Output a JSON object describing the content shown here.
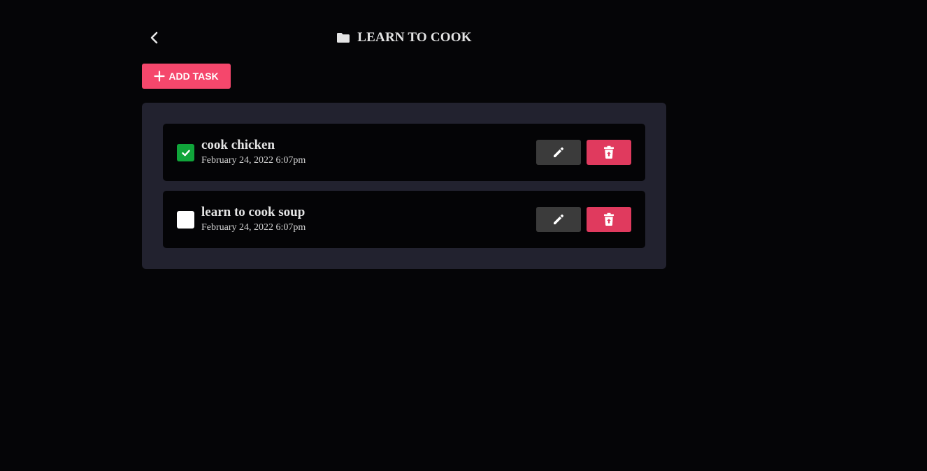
{
  "header": {
    "back_icon": "chevron-left-icon",
    "folder_icon": "folder-icon",
    "title": "LEARN TO COOK"
  },
  "toolbar": {
    "add_icon": "plus-icon",
    "add_label": "ADD TASK"
  },
  "tasks": [
    {
      "name": "cook chicken",
      "date": "February 24, 2022 6:07pm",
      "completed": true,
      "edit_icon": "pencil-icon",
      "delete_icon": "trash-icon"
    },
    {
      "name": "learn to cook soup",
      "date": "February 24, 2022 6:07pm",
      "completed": false,
      "edit_icon": "pencil-icon",
      "delete_icon": "trash-icon"
    }
  ],
  "colors": {
    "background": "#050507",
    "panel": "#22222f",
    "task_card": "#040406",
    "accent_add": "#f5476c",
    "delete": "#e03a5e",
    "edit": "#3b3b3b",
    "checked": "#10a53a"
  }
}
